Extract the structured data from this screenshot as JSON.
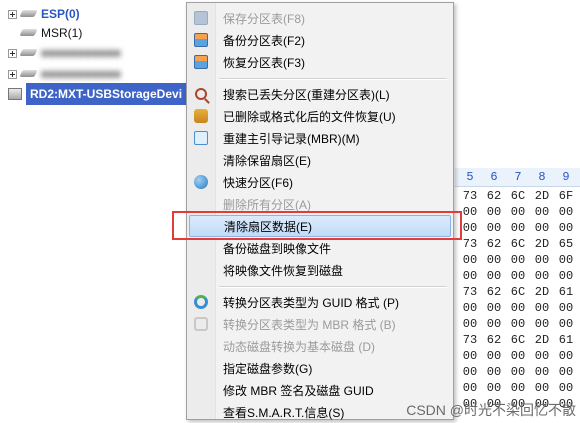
{
  "tree": {
    "items": [
      {
        "label": "ESP(0)",
        "style": "blue"
      },
      {
        "label": "MSR(1)",
        "style": "black"
      },
      {
        "label": "■■■■■■■■■■■",
        "style": "blurred"
      },
      {
        "label": "■■■■■■■■■■■",
        "style": "blurred"
      }
    ],
    "disk_label": "RD2:MXT-USBStorageDevi"
  },
  "hex": {
    "headers": [
      "5",
      "6",
      "7",
      "8",
      "9"
    ],
    "rows": [
      [
        "73",
        "62",
        "6C",
        "2D",
        "6F"
      ],
      [
        "00",
        "00",
        "00",
        "00",
        "00"
      ],
      [
        "00",
        "00",
        "00",
        "00",
        "00"
      ],
      [
        "73",
        "62",
        "6C",
        "2D",
        "65"
      ],
      [
        "00",
        "00",
        "00",
        "00",
        "00"
      ],
      [
        "00",
        "00",
        "00",
        "00",
        "00"
      ],
      [
        "73",
        "62",
        "6C",
        "2D",
        "61"
      ],
      [
        "00",
        "00",
        "00",
        "00",
        "00"
      ],
      [
        "00",
        "00",
        "00",
        "00",
        "00"
      ],
      [
        "73",
        "62",
        "6C",
        "2D",
        "61"
      ],
      [
        "00",
        "00",
        "00",
        "00",
        "00"
      ],
      [
        "00",
        "00",
        "00",
        "00",
        "00"
      ],
      [
        "00",
        "00",
        "00",
        "00",
        "00"
      ],
      [
        "00",
        "00",
        "00",
        "00",
        "00"
      ]
    ]
  },
  "menu": {
    "items": [
      {
        "label": "保存分区表(F8)",
        "disabled": true,
        "icon": "save-icon"
      },
      {
        "label": "备份分区表(F2)",
        "disabled": false,
        "icon": "backup-table-icon"
      },
      {
        "label": "恢复分区表(F3)",
        "disabled": false,
        "icon": "restore-table-icon"
      },
      {
        "label": "搜索已丢失分区(重建分区表)(L)",
        "disabled": false,
        "icon": "search-icon"
      },
      {
        "label": "已删除或格式化后的文件恢复(U)",
        "disabled": false,
        "icon": "file-recover-icon"
      },
      {
        "label": "重建主引导记录(MBR)(M)",
        "disabled": false,
        "icon": "edit-icon"
      },
      {
        "label": "清除保留扇区(E)",
        "disabled": false,
        "icon": ""
      },
      {
        "label": "快速分区(F6)",
        "disabled": false,
        "icon": "quick-partition-icon"
      },
      {
        "label": "删除所有分区(A)",
        "disabled": true,
        "icon": ""
      },
      {
        "label": "清除扇区数据(E)",
        "disabled": false,
        "icon": "",
        "hover": true
      },
      {
        "label": "备份磁盘到映像文件",
        "disabled": false,
        "icon": ""
      },
      {
        "label": "将映像文件恢复到磁盘",
        "disabled": false,
        "icon": ""
      },
      {
        "label": "转换分区表类型为 GUID 格式 (P)",
        "disabled": false,
        "icon": "convert-icon"
      },
      {
        "label": "转换分区表类型为 MBR 格式 (B)",
        "disabled": true,
        "icon": "convert-disabled-icon"
      },
      {
        "label": "动态磁盘转换为基本磁盘 (D)",
        "disabled": true,
        "icon": ""
      },
      {
        "label": "指定磁盘参数(G)",
        "disabled": false,
        "icon": ""
      },
      {
        "label": "修改 MBR 签名及磁盘 GUID",
        "disabled": false,
        "icon": ""
      },
      {
        "label": "查看S.M.A.R.T.信息(S)",
        "disabled": false,
        "icon": ""
      }
    ]
  },
  "watermark": "CSDN @时光不染回忆不散"
}
